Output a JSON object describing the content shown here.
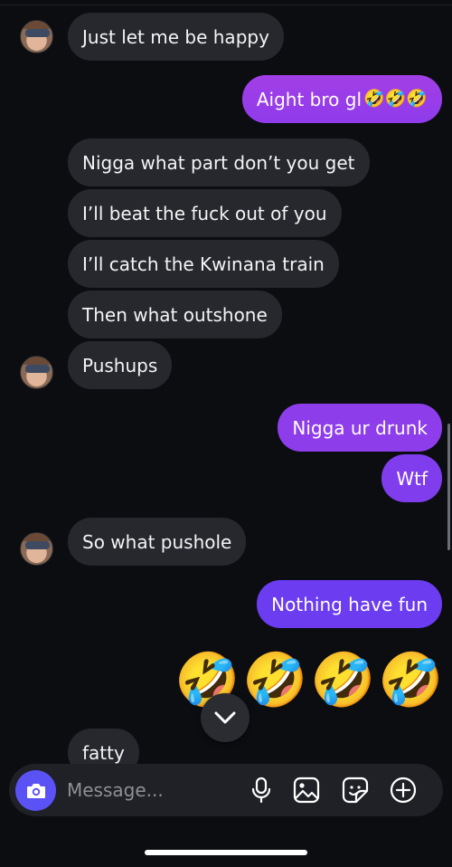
{
  "colors": {
    "background": "#0b0d11",
    "received_bubble": "#26282d",
    "sent_gradient_top": "#a23ee6",
    "sent_gradient_bottom": "#6b3cf0",
    "camera_button": "#5b52f5"
  },
  "messages": [
    {
      "side": "received",
      "text": "Just let me be happy"
    },
    {
      "side": "sent",
      "text": "Aight bro gl",
      "emoji": "🤣🤣🤣"
    },
    {
      "side": "received",
      "text": "Nigga what part don’t you get"
    },
    {
      "side": "received",
      "text": "I’ll beat the fuck out of you"
    },
    {
      "side": "received",
      "text": "I’ll catch the Kwinana train"
    },
    {
      "side": "received",
      "text": "Then what outshone"
    },
    {
      "side": "received",
      "text": "Pushups"
    },
    {
      "side": "sent",
      "text": "Nigga ur drunk"
    },
    {
      "side": "sent",
      "text": "Wtf"
    },
    {
      "side": "received",
      "text": "So what pushole"
    },
    {
      "side": "sent",
      "text": "Nothing have fun"
    },
    {
      "side": "sent",
      "emoji_only": [
        "🤣",
        "🤣",
        "🤣",
        "🤣"
      ]
    },
    {
      "side": "received",
      "text": "fatty"
    }
  ],
  "composer": {
    "placeholder": "Message...",
    "icons": [
      "camera-icon",
      "microphone-icon",
      "gallery-icon",
      "sticker-icon",
      "plus-icon"
    ]
  },
  "jump_button_icon": "chevron-down-icon"
}
